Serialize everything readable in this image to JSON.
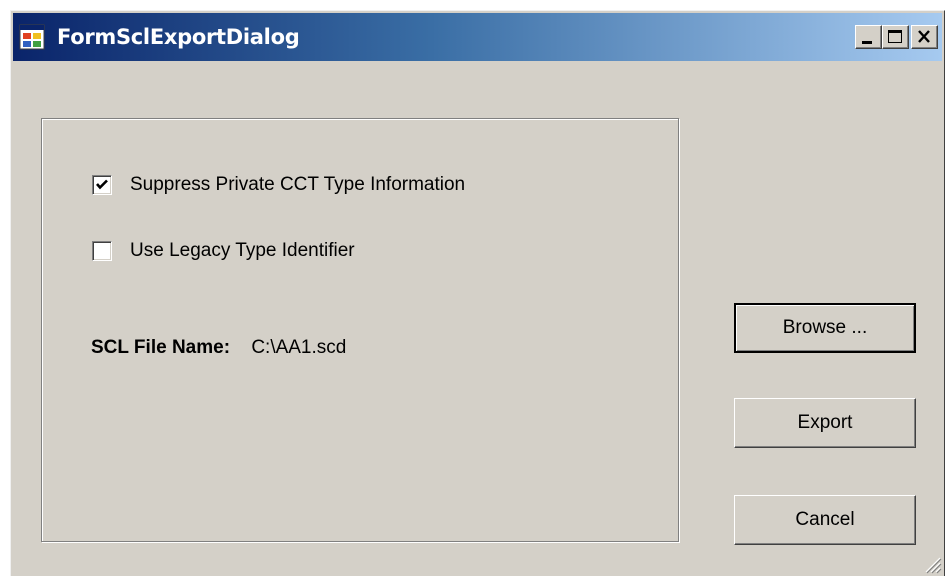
{
  "window": {
    "title": "FormSclExportDialog",
    "title_gradient": [
      "#0a246a",
      "#a6caf0"
    ],
    "face_color": "#d4d0c8"
  },
  "titlebar_buttons": [
    {
      "name": "minimize",
      "icon": "minimize-icon"
    },
    {
      "name": "maximize",
      "icon": "maximize-icon"
    },
    {
      "name": "close",
      "icon": "close-icon"
    }
  ],
  "options": {
    "suppress_private": {
      "label": "Suppress Private CCT Type Information",
      "checked": true
    },
    "legacy_identifier": {
      "label": "Use Legacy Type Identifier",
      "checked": false
    }
  },
  "file": {
    "label": "SCL File Name:",
    "value": "C:\\AA1.scd"
  },
  "buttons": {
    "browse": "Browse ...",
    "export": "Export",
    "cancel": "Cancel"
  }
}
